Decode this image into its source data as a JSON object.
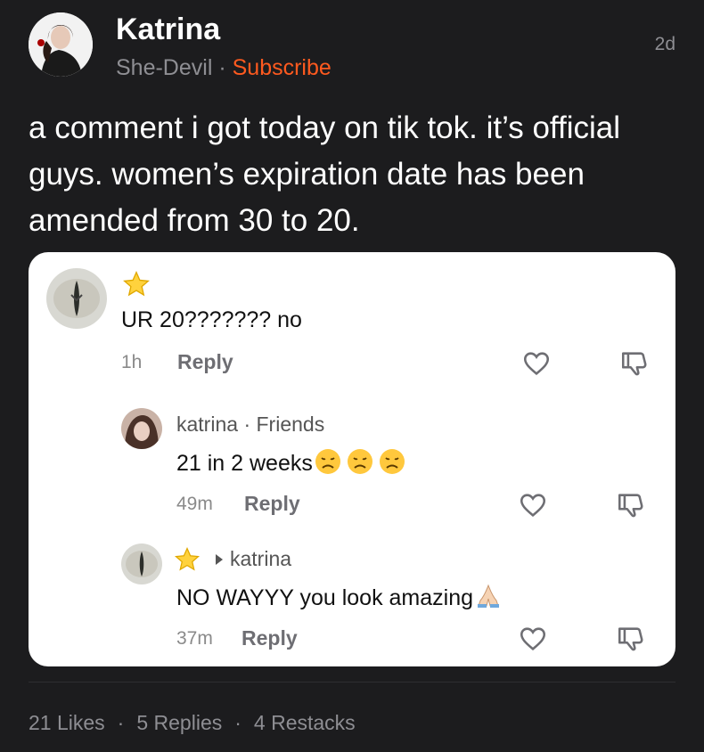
{
  "post": {
    "author_name": "Katrina",
    "publication": "She-Devil",
    "separator": "·",
    "subscribe_label": "Subscribe",
    "time_ago": "2d",
    "text": "a comment i got today on tik tok. it’s official guys. women’s expiration date has been amended from 30 to 20."
  },
  "screenshot": {
    "comments": [
      {
        "text": "UR 20??????? no",
        "time": "1h",
        "reply_label": "Reply"
      },
      {
        "author": "katrina",
        "relation": "Friends",
        "text": "21 in 2 weeks",
        "time": "49m",
        "reply_label": "Reply"
      },
      {
        "reply_to": "katrina",
        "text": "NO WAYYY you look amazing",
        "time": "37m",
        "reply_label": "Reply"
      }
    ]
  },
  "stats": {
    "likes": "21 Likes",
    "replies": "5 Replies",
    "restacks": "4 Restacks",
    "separator": "·"
  },
  "colors": {
    "background": "#1c1c1e",
    "accent": "#ff5a1f",
    "muted": "#8e8e93"
  },
  "icons": [
    "star-icon",
    "heart-icon",
    "thumbs-down-icon",
    "sad-face-emoji",
    "praying-hands-emoji",
    "caret-right-icon"
  ]
}
